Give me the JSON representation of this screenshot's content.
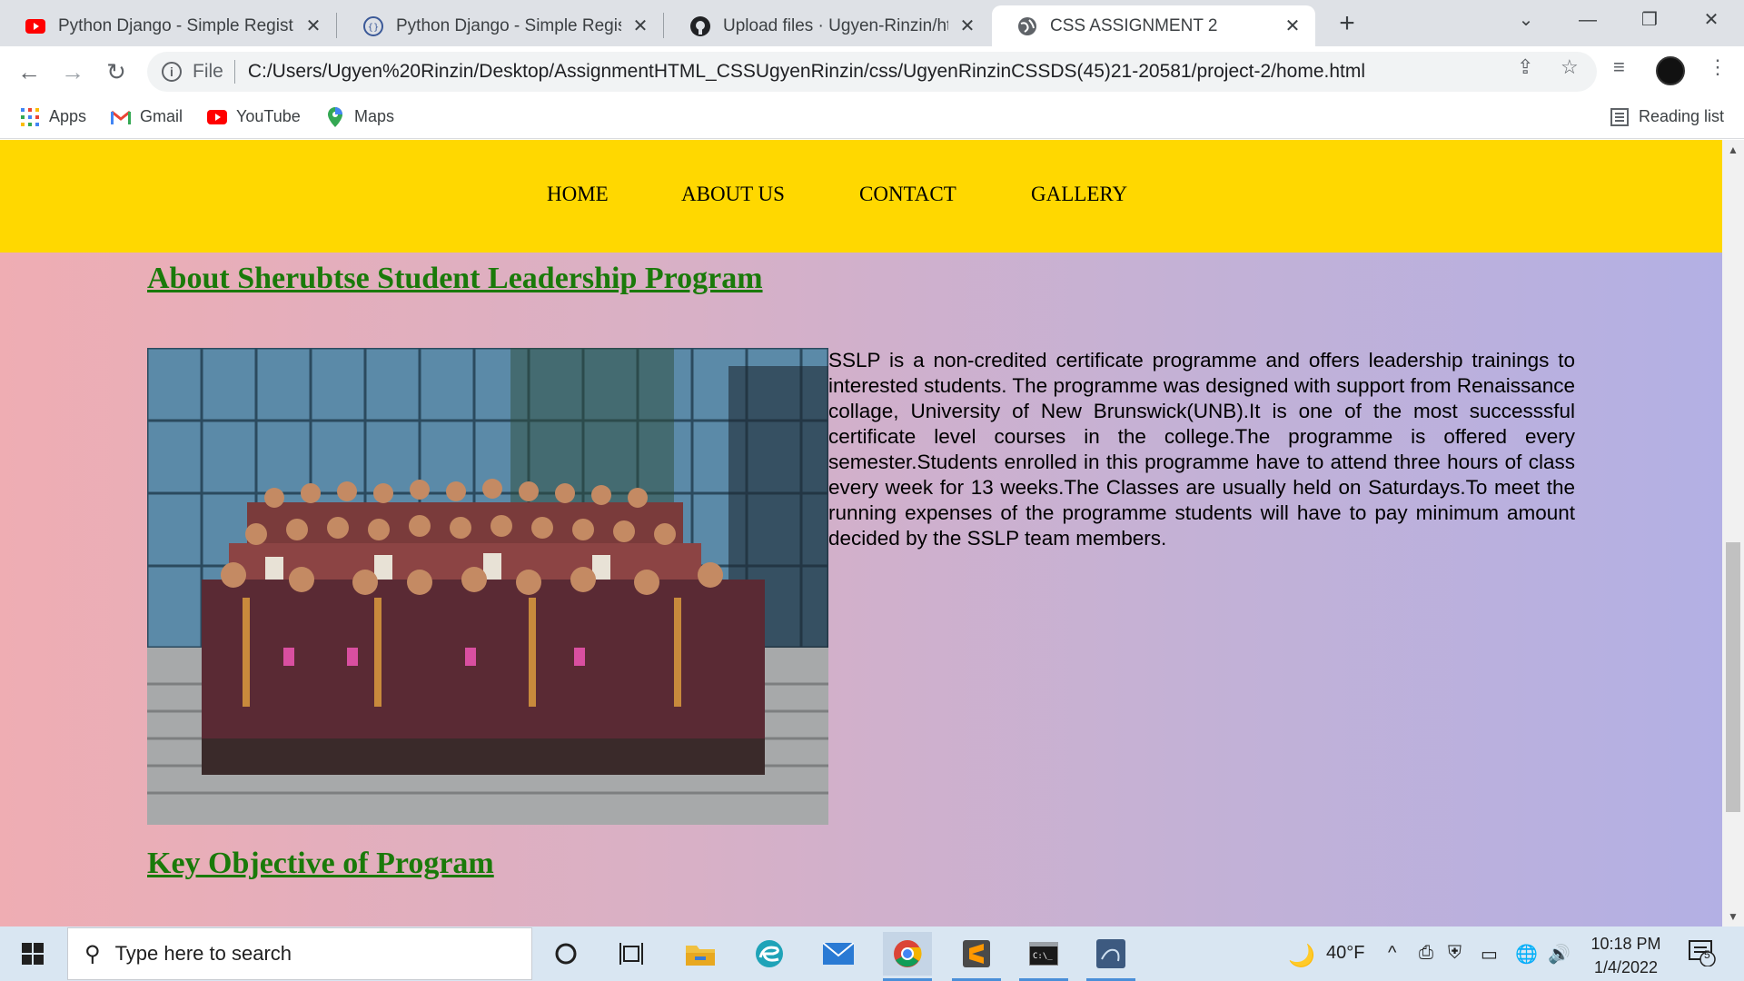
{
  "browser": {
    "tabs": [
      {
        "title": "Python Django - Simple Registrat",
        "icon": "youtube-icon",
        "active": false
      },
      {
        "title": "Python Django - Simple Registrat",
        "icon": "sourcecodester-icon",
        "active": false
      },
      {
        "title": "Upload files · Ugyen-Rinzin/html_",
        "icon": "github-icon",
        "active": false
      },
      {
        "title": "CSS ASSIGNMENT 2",
        "icon": "globe-icon",
        "active": true
      }
    ],
    "address": {
      "scheme": "File",
      "url": "C:/Users/Ugyen%20Rinzin/Desktop/AssignmentHTML_CSSUgyenRinzin/css/UgyenRinzinCSSDS(45)21-20581/project-2/home.html"
    },
    "bookmarks": [
      {
        "label": "Apps",
        "icon": "apps-grid-icon"
      },
      {
        "label": "Gmail",
        "icon": "gmail-icon"
      },
      {
        "label": "YouTube",
        "icon": "youtube-icon"
      },
      {
        "label": "Maps",
        "icon": "maps-pin-icon"
      }
    ],
    "reading_list": "Reading list"
  },
  "page": {
    "nav": [
      "HOME",
      "ABOUT US",
      "CONTACT",
      "GALLERY"
    ],
    "colors": {
      "navbar": "#ffd800",
      "heading": "#1a7a0a",
      "gradient_left": "#efadb3",
      "gradient_right": "#b3b0e4"
    },
    "heading1": "About Sherubtse Student Leadership Program",
    "paragraph": "SSLP is a non-credited certificate programme and offers leadership trainings to interested students. The programme was designed with support from Renaissance collage, University of New Brunswick(UNB).It is one of the most successsful certificate level courses in the college.The programme is offered every semester.Students enrolled in this programme have to attend three hours of class every week for 13 weeks.The Classes are usually held on Saturdays.To meet the running expenses of the programme students will have to pay minimum amount decided by the SSLP team members.",
    "heading2": "Key Objective of Program"
  },
  "taskbar": {
    "search_placeholder": "Type here to search",
    "weather": "40°F",
    "time": "10:18 PM",
    "date": "1/4/2022",
    "notifications": "5"
  }
}
